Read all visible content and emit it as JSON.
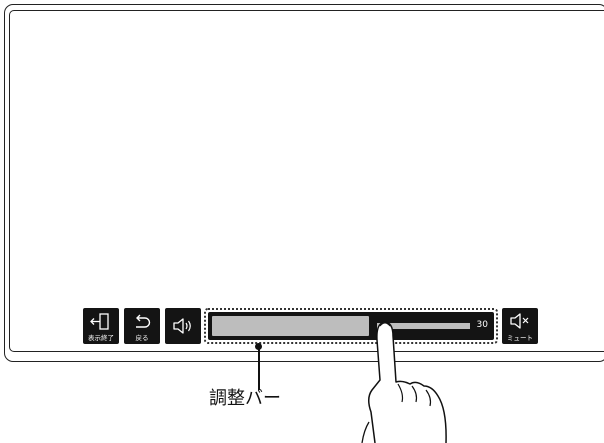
{
  "toolbar": {
    "exit_label": "表示終了",
    "back_label": "戻る",
    "mute_label": "ミュート",
    "exit_icon": "exit-door-icon",
    "back_icon": "undo-arrow-icon",
    "speaker_icon": "speaker-volume-icon",
    "mute_icon": "speaker-mute-icon"
  },
  "volume_bar": {
    "value": "30",
    "level_fraction": 0.61
  },
  "callout": {
    "label": "調整バー"
  },
  "colors": {
    "button_bg": "#141414",
    "bar_fill": "#bdbdbd"
  }
}
